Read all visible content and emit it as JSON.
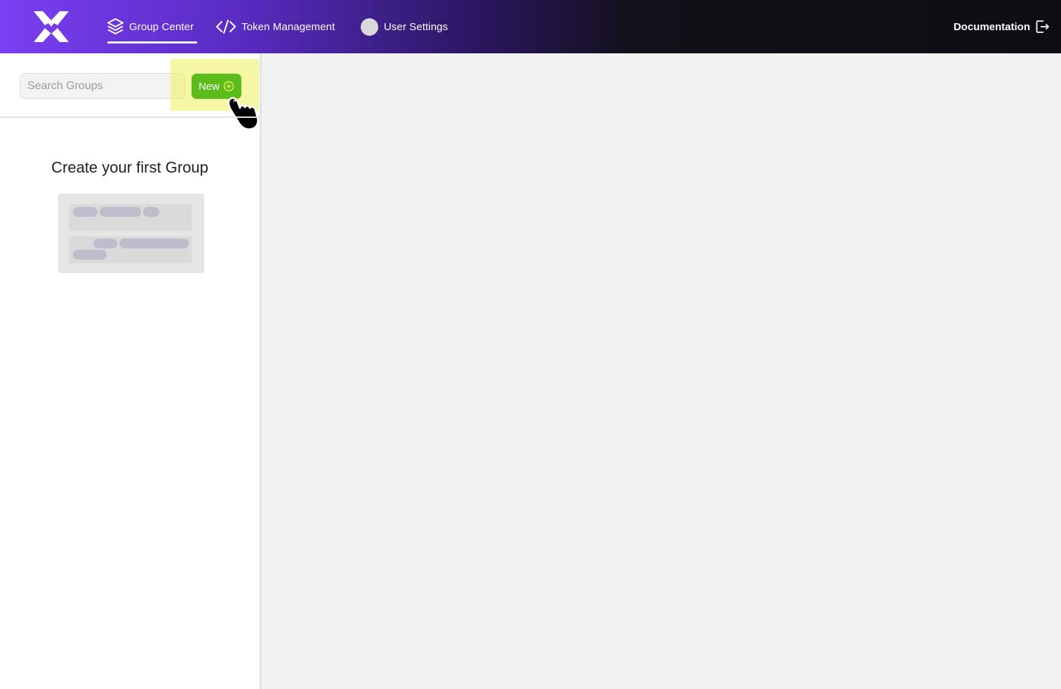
{
  "header": {
    "nav": [
      {
        "label": "Group Center",
        "icon": "layers-icon",
        "active": true
      },
      {
        "label": "Token Management",
        "icon": "code-icon"
      },
      {
        "label": "User Settings",
        "icon": "avatar-icon"
      }
    ],
    "documentation_label": "Documentation"
  },
  "sidebar": {
    "search_placeholder": "Search Groups",
    "new_button_label": "New",
    "empty_title": "Create your first Group"
  },
  "colors": {
    "accent_purple": "#7b3ff2",
    "new_button_green": "#5cbc1c",
    "highlight_yellow": "#ecf05a"
  }
}
